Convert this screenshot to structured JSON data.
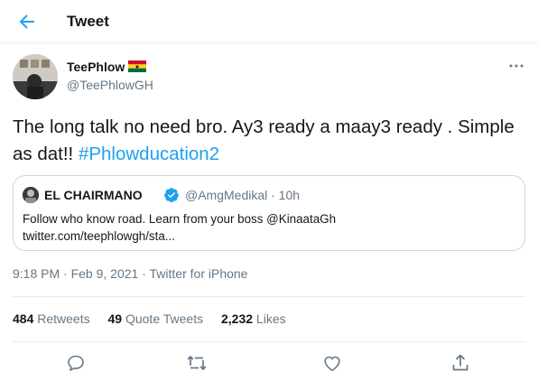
{
  "header": {
    "title": "Tweet",
    "back_icon": "arrow-left-icon"
  },
  "author": {
    "display_name": "TeePhlow",
    "handle": "@TeePhlowGH",
    "flag_icon": "ghana-flag-icon"
  },
  "tweet": {
    "text": "The long talk no need bro. Ay3 ready a maay3 ready . Simple as dat!! ",
    "hashtag": "#Phlowducation2"
  },
  "quote": {
    "name": "EL CHAIRMANO",
    "handle_time": "@AmgMedikal · 10h",
    "text_line1": "Follow who know road. Learn from your boss @KinaataGh",
    "text_line2": "twitter.com/teephlowgh/sta..."
  },
  "meta": {
    "time": "9:18 PM",
    "separator": " · ",
    "date": "Feb 9, 2021",
    "source": "Twitter for iPhone"
  },
  "stats": {
    "retweets_count": "484",
    "retweets_label": " Retweets",
    "quotes_count": "49",
    "quotes_label": " Quote Tweets",
    "likes_count": "2,232",
    "likes_label": " Likes"
  },
  "colors": {
    "accent": "#1da1f2",
    "secondary_text": "#657786",
    "border": "#e6ecf0"
  }
}
